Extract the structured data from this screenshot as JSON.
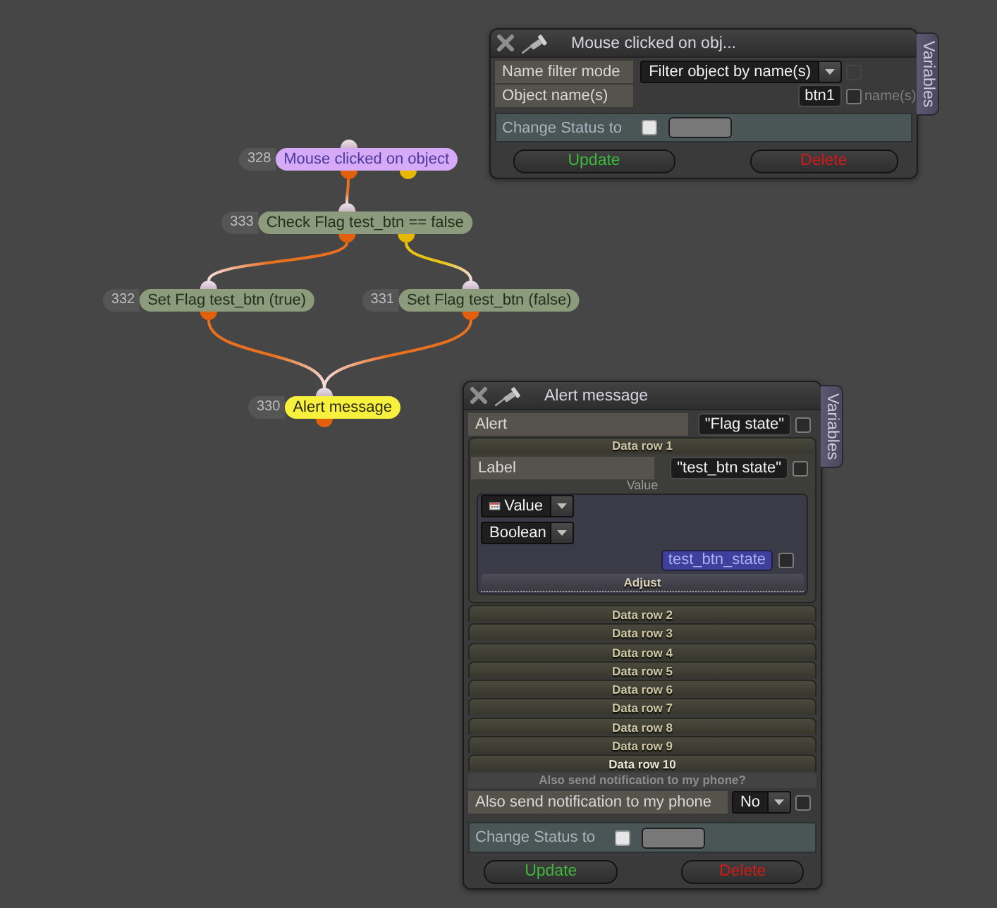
{
  "graph": {
    "nodes": [
      {
        "number": "328",
        "title": "Mouse clicked on object",
        "kind": "event"
      },
      {
        "number": "333",
        "title": "Check Flag test_btn == false",
        "kind": "condition"
      },
      {
        "number": "332",
        "title": "Set Flag test_btn (true)",
        "kind": "action"
      },
      {
        "number": "331",
        "title": "Set Flag test_btn (false)",
        "kind": "action"
      },
      {
        "number": "330",
        "title": "Alert message",
        "kind": "message"
      }
    ]
  },
  "panels": [
    {
      "title": "Mouse clicked on obj...",
      "side_tab": "Variables",
      "rows": [
        {
          "kind": "dropdown",
          "label": "Name filter mode",
          "value": "Filter object by name(s)",
          "checkbox": {
            "checked": false,
            "disabled": true
          }
        },
        {
          "kind": "text",
          "label": "Object name(s)",
          "value": "btn1",
          "checkbox": {
            "checked": false,
            "disabled": false
          },
          "note": "name(s)"
        }
      ],
      "status": {
        "label": "Change Status to",
        "checked": false
      },
      "buttons": [
        {
          "label": "Update",
          "kind": "update"
        },
        {
          "label": "Delete",
          "kind": "delete"
        }
      ]
    },
    {
      "title": "Alert message",
      "side_tab": "Variables",
      "rows": [
        {
          "kind": "text",
          "label": "Alert",
          "value": "\"Flag state\"",
          "checkbox": {
            "checked": false,
            "disabled": false
          }
        }
      ],
      "data_rows": [
        {
          "title": "Data row 1",
          "expanded": true,
          "highlighted": false,
          "label": {
            "label": "Label",
            "value": "\"test_btn state\"",
            "checked": false
          },
          "value": {
            "caption": "Value",
            "source": "Value",
            "type": "Boolean",
            "variable": "test_btn_state",
            "checked": false,
            "action": "Adjust"
          }
        },
        {
          "title": "Data row 2",
          "expanded": false,
          "highlighted": false
        },
        {
          "title": "Data row 3",
          "expanded": false,
          "highlighted": false
        },
        {
          "title": "Data row 4",
          "expanded": false,
          "highlighted": false
        },
        {
          "title": "Data row 5",
          "expanded": false,
          "highlighted": false
        },
        {
          "title": "Data row 6",
          "expanded": false,
          "highlighted": false
        },
        {
          "title": "Data row 7",
          "expanded": false,
          "highlighted": false
        },
        {
          "title": "Data row 8",
          "expanded": false,
          "highlighted": false
        },
        {
          "title": "Data row 9",
          "expanded": false,
          "highlighted": false
        },
        {
          "title": "Data row 10",
          "expanded": false,
          "highlighted": true
        }
      ],
      "notification": {
        "header": "Also send notification to my phone?",
        "label": "Also send notification to my phone",
        "value": "No",
        "checked": false
      },
      "status": {
        "label": "Change Status to",
        "checked": false
      },
      "buttons": [
        {
          "label": "Update",
          "kind": "update"
        },
        {
          "label": "Delete",
          "kind": "delete"
        }
      ]
    }
  ]
}
